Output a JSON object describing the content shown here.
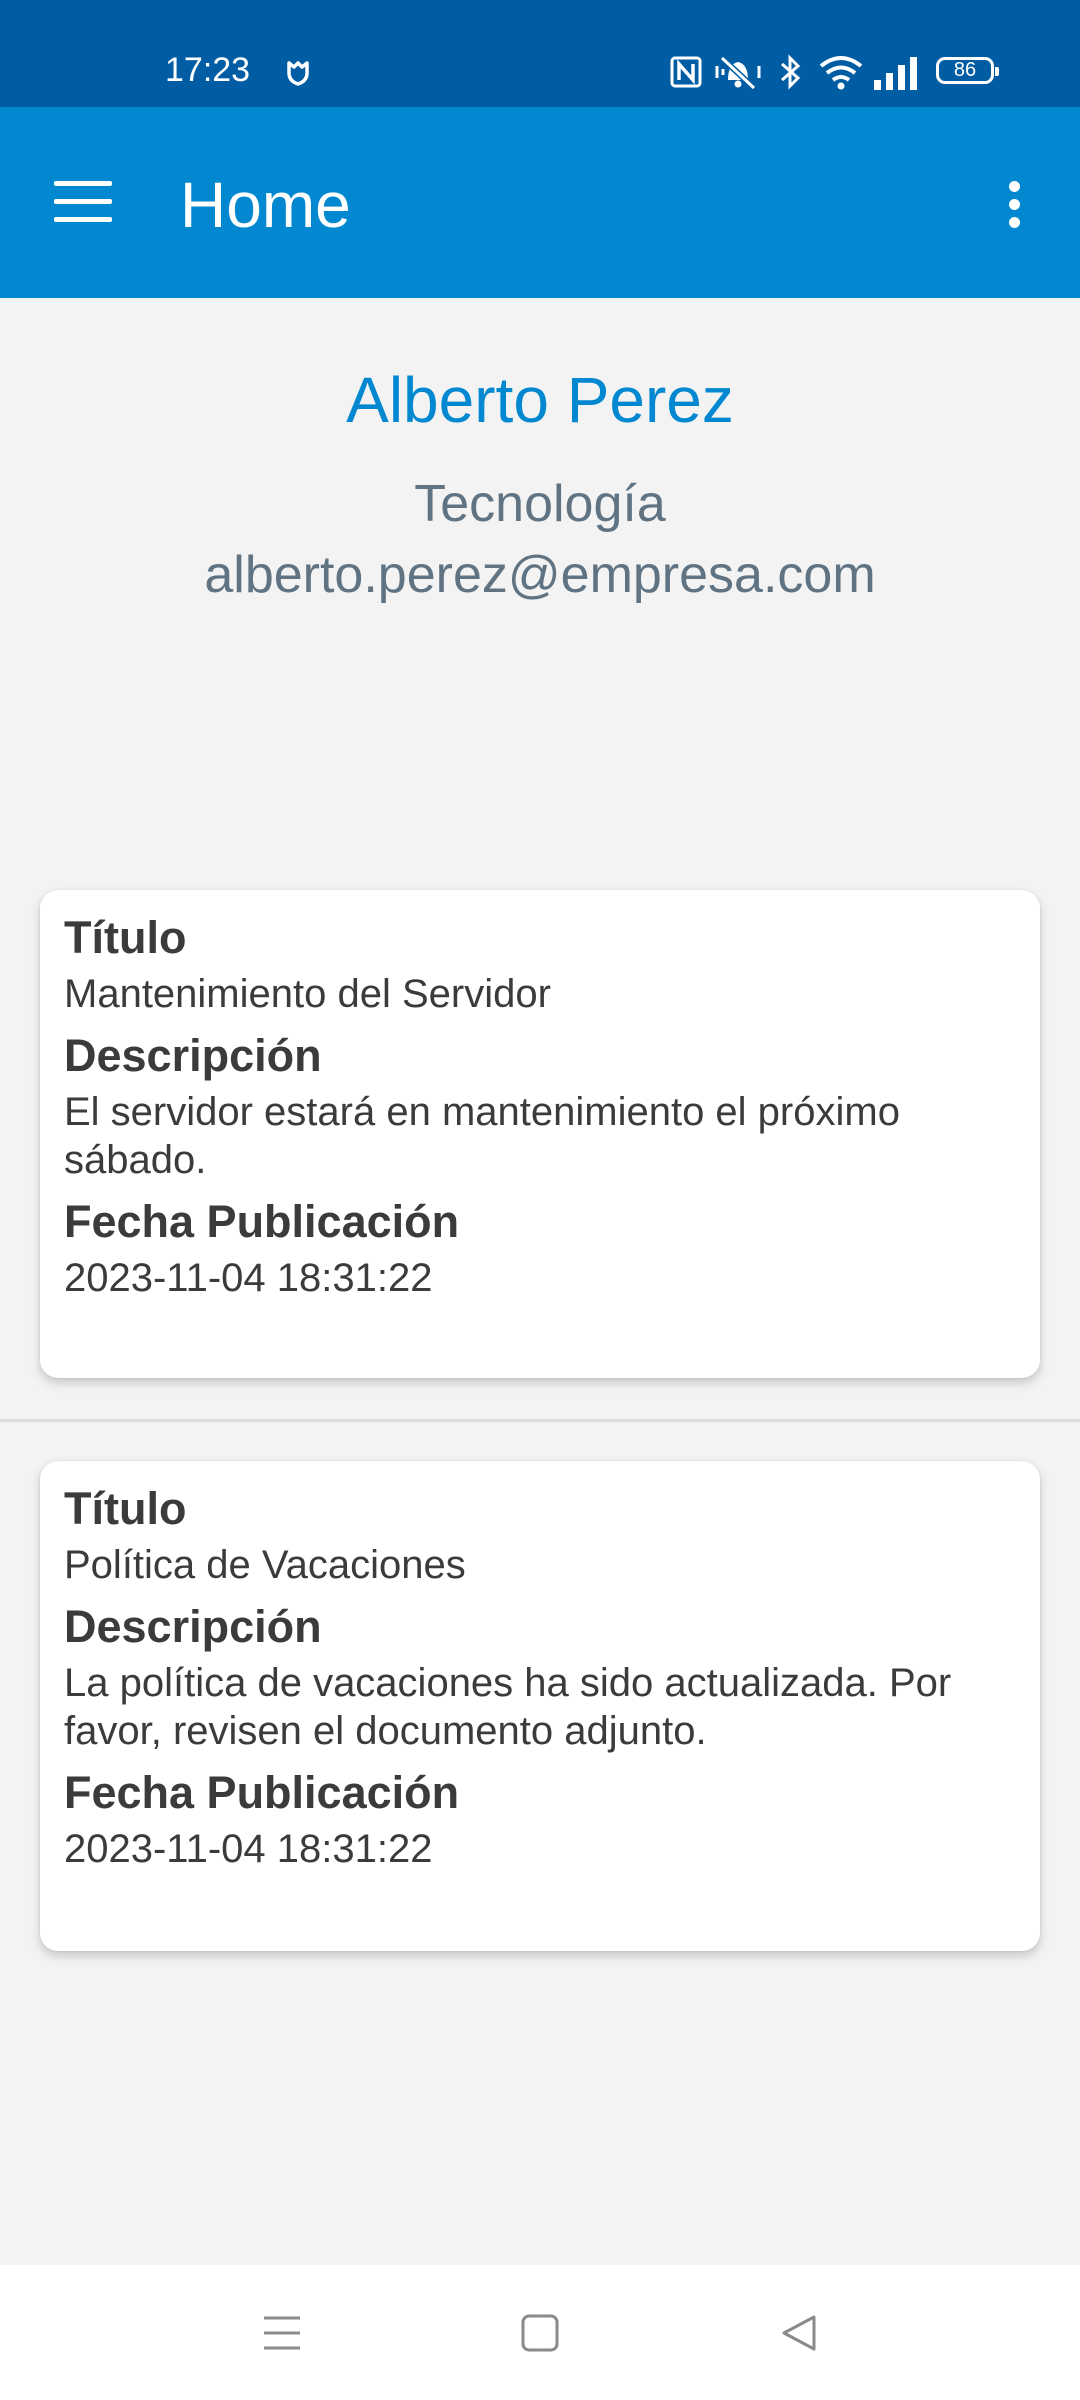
{
  "status_bar": {
    "time": "17:23",
    "battery": "86",
    "icons": [
      "shield-notification-icon",
      "nfc-icon",
      "vibrate-icon",
      "bluetooth-icon",
      "wifi-icon",
      "signal-icon",
      "battery-icon"
    ]
  },
  "app_bar": {
    "title": "Home",
    "menu_icon": "hamburger-menu-icon",
    "overflow_icon": "more-vert-icon"
  },
  "profile": {
    "name": "Alberto Perez",
    "department": "Tecnología",
    "email": "alberto.perez@empresa.com"
  },
  "announcements": [
    {
      "title_label": "Título",
      "title": "Mantenimiento del Servidor",
      "description_label": "Descripción",
      "description": "El servidor estará en mantenimiento el próximo sábado.",
      "date_label": "Fecha Publicación",
      "date": "2023-11-04 18:31:22"
    },
    {
      "title_label": "Título",
      "title": "Política de Vacaciones",
      "description_label": "Descripción",
      "description": "La política de vacaciones ha sido actualizada. Por favor, revisen el documento adjunto.",
      "date_label": "Fecha Publicación",
      "date": "2023-11-04 18:31:22"
    }
  ],
  "nav_bar": {
    "icons": [
      "recents-icon",
      "home-icon",
      "back-icon"
    ]
  },
  "colors": {
    "status_bar": "#005da4",
    "app_bar": "#0288d1",
    "accent": "#0288d1",
    "subtitle": "#5f7383",
    "background": "#f3f3f3"
  }
}
